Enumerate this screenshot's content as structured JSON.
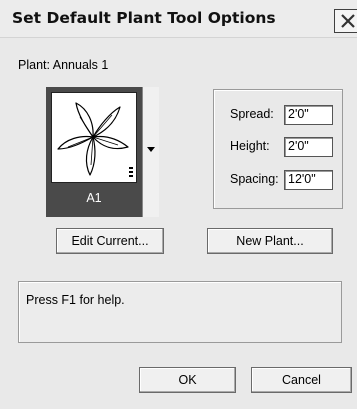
{
  "window": {
    "title": "Set Default Plant Tool Options"
  },
  "plant": {
    "label": "Plant: Annuals 1",
    "preview_name": "A1",
    "icon": "flower-glyph-icon"
  },
  "dimensions": {
    "spread_label": "Spread:",
    "spread_value": "2'0\"",
    "height_label": "Height:",
    "height_value": "2'0\"",
    "spacing_label": "Spacing:",
    "spacing_value": "12'0\""
  },
  "buttons": {
    "edit_current": "Edit Current...",
    "new_plant": "New Plant...",
    "ok": "OK",
    "cancel": "Cancel"
  },
  "help": {
    "text": "Press F1 for help."
  }
}
